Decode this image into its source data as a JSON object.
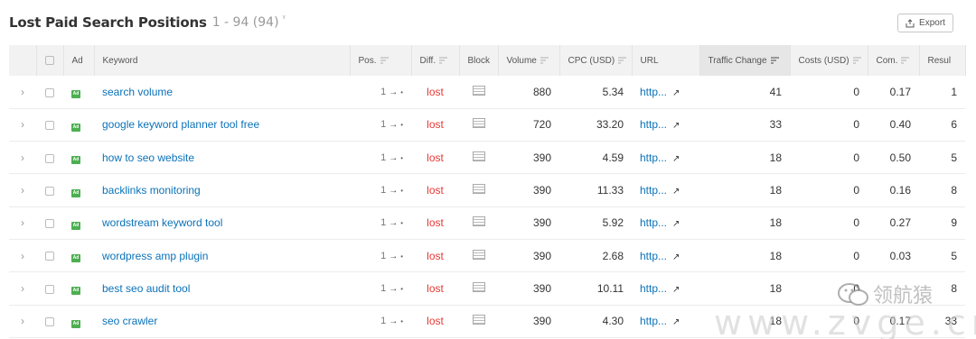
{
  "header": {
    "title": "Lost Paid Search Positions",
    "range": "1 - 94 (94)",
    "sort_mark": "ʸ",
    "export_label": "Export"
  },
  "columns": {
    "ad": "Ad",
    "keyword": "Keyword",
    "pos": "Pos.",
    "diff": "Diff.",
    "block": "Block",
    "volume": "Volume",
    "cpc": "CPC (USD)",
    "url": "URL",
    "traffic_change": "Traffic Change",
    "costs": "Costs (USD)",
    "com": "Com.",
    "results": "Resul"
  },
  "rows": [
    {
      "keyword": "search volume",
      "pos_from": "1",
      "arrow": "→",
      "pos_to": "•",
      "diff": "lost",
      "volume": "880",
      "cpc": "5.34",
      "url": "http...",
      "traffic_change": "41",
      "costs": "0",
      "com": "0.17",
      "results": "1"
    },
    {
      "keyword": "google keyword planner tool free",
      "pos_from": "1",
      "arrow": "→",
      "pos_to": "•",
      "diff": "lost",
      "volume": "720",
      "cpc": "33.20",
      "url": "http...",
      "traffic_change": "33",
      "costs": "0",
      "com": "0.40",
      "results": "6"
    },
    {
      "keyword": "how to seo website",
      "pos_from": "1",
      "arrow": "→",
      "pos_to": "•",
      "diff": "lost",
      "volume": "390",
      "cpc": "4.59",
      "url": "http...",
      "traffic_change": "18",
      "costs": "0",
      "com": "0.50",
      "results": "5"
    },
    {
      "keyword": "backlinks monitoring",
      "pos_from": "1",
      "arrow": "→",
      "pos_to": "•",
      "diff": "lost",
      "volume": "390",
      "cpc": "11.33",
      "url": "http...",
      "traffic_change": "18",
      "costs": "0",
      "com": "0.16",
      "results": "8"
    },
    {
      "keyword": "wordstream keyword tool",
      "pos_from": "1",
      "arrow": "→",
      "pos_to": "•",
      "diff": "lost",
      "volume": "390",
      "cpc": "5.92",
      "url": "http...",
      "traffic_change": "18",
      "costs": "0",
      "com": "0.27",
      "results": "9"
    },
    {
      "keyword": "wordpress amp plugin",
      "pos_from": "1",
      "arrow": "→",
      "pos_to": "•",
      "diff": "lost",
      "volume": "390",
      "cpc": "2.68",
      "url": "http...",
      "traffic_change": "18",
      "costs": "0",
      "com": "0.03",
      "results": "5"
    },
    {
      "keyword": "best seo audit tool",
      "pos_from": "1",
      "arrow": "→",
      "pos_to": "•",
      "diff": "lost",
      "volume": "390",
      "cpc": "10.11",
      "url": "http...",
      "traffic_change": "18",
      "costs": "0",
      "com": "",
      "results": "8"
    },
    {
      "keyword": "seo crawler",
      "pos_from": "1",
      "arrow": "→",
      "pos_to": "•",
      "diff": "lost",
      "volume": "390",
      "cpc": "4.30",
      "url": "http...",
      "traffic_change": "18",
      "costs": "0",
      "com": "0.17",
      "results": "33"
    }
  ],
  "icons": {
    "expand": "chevron-right-icon",
    "ad": "ad-badge-icon",
    "block": "block-snippet-icon",
    "external": "external-link-icon",
    "export": "export-icon",
    "filter": "sort-filter-icon"
  },
  "watermark": {
    "brand": "领航猿",
    "url": "www.zvge.cn"
  },
  "colors": {
    "link": "#0b72b9",
    "lost": "#e53935",
    "ad_badge": "#4caf50",
    "header_bg": "#f2f2f2"
  }
}
